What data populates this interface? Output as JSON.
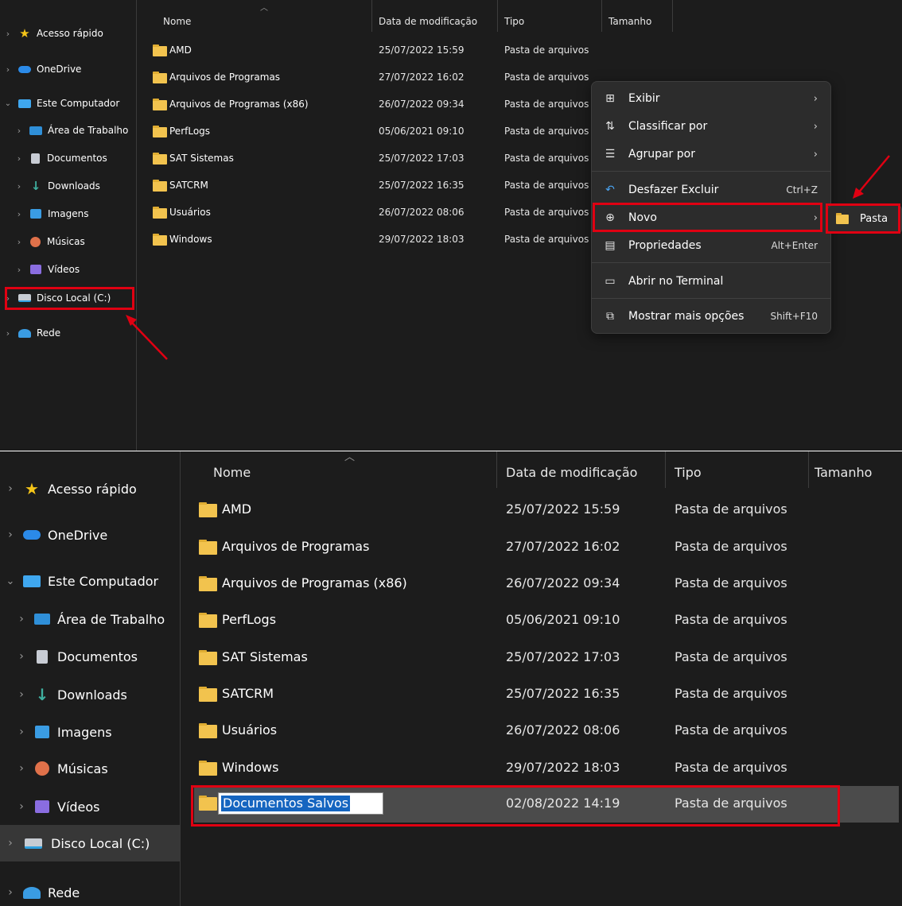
{
  "nav": {
    "quick_access": "Acesso rápido",
    "onedrive": "OneDrive",
    "this_pc": "Este Computador",
    "desktop": "Área de Trabalho",
    "documents": "Documentos",
    "downloads": "Downloads",
    "pictures": "Imagens",
    "music": "Músicas",
    "videos": "Vídeos",
    "local_disk": "Disco Local (C:)",
    "network": "Rede"
  },
  "columns": {
    "name": "Nome",
    "modified": "Data de modificação",
    "type": "Tipo",
    "size": "Tamanho"
  },
  "files": [
    {
      "name": "AMD",
      "date": "25/07/2022 15:59",
      "type": "Pasta de arquivos"
    },
    {
      "name": "Arquivos de Programas",
      "date": "27/07/2022 16:02",
      "type": "Pasta de arquivos"
    },
    {
      "name": "Arquivos de Programas (x86)",
      "date": "26/07/2022 09:34",
      "type": "Pasta de arquivos"
    },
    {
      "name": "PerfLogs",
      "date": "05/06/2021 09:10",
      "type": "Pasta de arquivos"
    },
    {
      "name": "SAT Sistemas",
      "date": "25/07/2022 17:03",
      "type": "Pasta de arquivos"
    },
    {
      "name": "SATCRM",
      "date": "25/07/2022 16:35",
      "type": "Pasta de arquivos"
    },
    {
      "name": "Usuários",
      "date": "26/07/2022 08:06",
      "type": "Pasta de arquivos"
    },
    {
      "name": "Windows",
      "date": "29/07/2022 18:03",
      "type": "Pasta de arquivos"
    }
  ],
  "new_folder": {
    "name": "Documentos Salvos",
    "date": "02/08/2022 14:19",
    "type": "Pasta de arquivos"
  },
  "context_menu": {
    "view": "Exibir",
    "sort_by": "Classificar por",
    "group_by": "Agrupar por",
    "undo_delete": "Desfazer Excluir",
    "undo_shortcut": "Ctrl+Z",
    "new": "Novo",
    "properties": "Propriedades",
    "properties_shortcut": "Alt+Enter",
    "open_terminal": "Abrir no Terminal",
    "more_options": "Mostrar mais opções",
    "more_options_shortcut": "Shift+F10"
  },
  "submenu": {
    "folder": "Pasta"
  },
  "colors": {
    "background": "#1c1c1c",
    "highlight": "#e00012",
    "folder": "#f2c34e",
    "menu": "#2c2c2c"
  }
}
